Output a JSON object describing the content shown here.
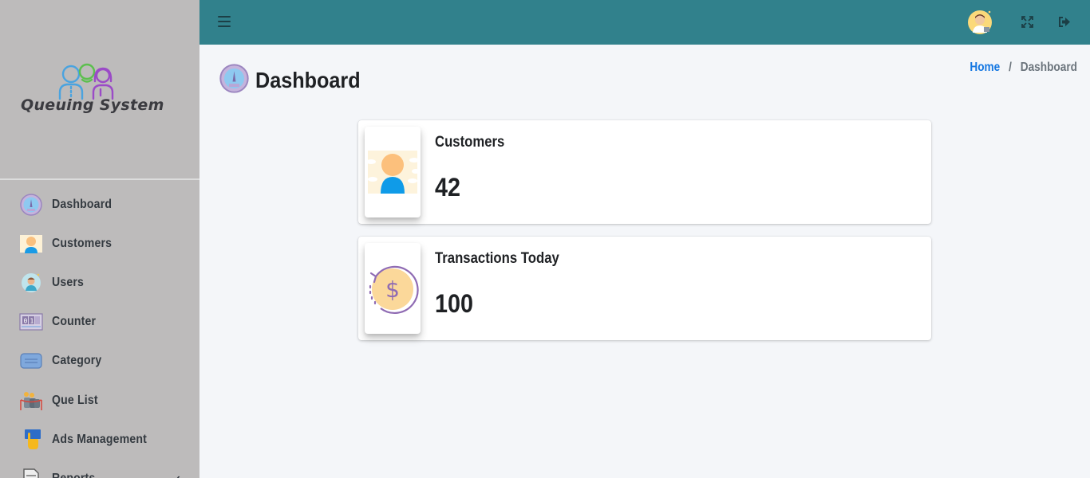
{
  "brand": {
    "name": "Queuing System",
    "logo_icon": "three-people-icon"
  },
  "sidebar": {
    "items": [
      {
        "label": "Dashboard",
        "icon": "dashboard-gauge-icon"
      },
      {
        "label": "Customers",
        "icon": "customer-icon"
      },
      {
        "label": "Users",
        "icon": "user-avatar-icon"
      },
      {
        "label": "Counter",
        "icon": "counter-display-icon"
      },
      {
        "label": "Category",
        "icon": "category-card-icon"
      },
      {
        "label": "Que List",
        "icon": "queue-people-icon"
      },
      {
        "label": "Ads Management",
        "icon": "ads-touch-icon"
      },
      {
        "label": "Reports",
        "icon": "report-document-icon",
        "has_submenu": true
      }
    ]
  },
  "topbar": {
    "menu_icon": "hamburger-icon",
    "user_icon": "user-avatar-icon",
    "fullscreen_icon": "expand-icon",
    "logout_icon": "sign-out-icon",
    "color": "#31818c"
  },
  "page": {
    "title": "Dashboard",
    "title_icon": "dashboard-gauge-icon",
    "breadcrumb": {
      "home": "Home",
      "separator": "/",
      "current": "Dashboard"
    }
  },
  "cards": [
    {
      "title": "Customers",
      "value": "42",
      "icon": "customer-icon"
    },
    {
      "title": "Transactions Today",
      "value": "100",
      "icon": "dollar-coin-icon"
    }
  ],
  "colors": {
    "sidebar_bg": "#bdbbbb",
    "topbar_bg": "#31818c",
    "link": "#1477e2",
    "text_dark": "#1f2124"
  }
}
